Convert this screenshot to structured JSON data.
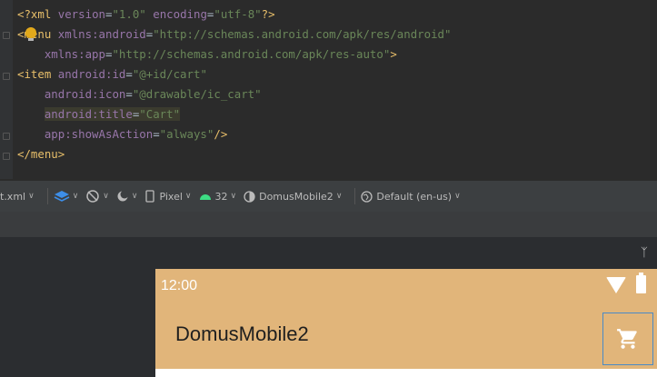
{
  "editor": {
    "lines": [
      {
        "parts": [
          [
            "pi",
            "<?xml "
          ],
          [
            "attr",
            "version"
          ],
          [
            "plain",
            "="
          ],
          [
            "val",
            "\"1.0\""
          ],
          [
            "plain",
            " "
          ],
          [
            "attr",
            "encoding"
          ],
          [
            "plain",
            "="
          ],
          [
            "val",
            "\"utf-8\""
          ],
          [
            "pi",
            "?>"
          ]
        ]
      },
      {
        "parts": [
          [
            "tag",
            "<menu "
          ],
          [
            "ns",
            "xmlns:android"
          ],
          [
            "plain",
            "="
          ],
          [
            "val",
            "\"http://schemas.android.com/apk/res/android\""
          ]
        ]
      },
      {
        "parts": [
          [
            "plain",
            "    "
          ],
          [
            "ns",
            "xmlns:app"
          ],
          [
            "plain",
            "="
          ],
          [
            "val",
            "\"http://schemas.android.com/apk/res-auto\""
          ],
          [
            "tag",
            ">"
          ]
        ]
      },
      {
        "parts": [
          [
            "tag",
            "<item "
          ],
          [
            "ns",
            "android:id"
          ],
          [
            "plain",
            "="
          ],
          [
            "val",
            "\"@+id/cart\""
          ]
        ]
      },
      {
        "parts": [
          [
            "plain",
            "    "
          ],
          [
            "ns",
            "android:icon"
          ],
          [
            "plain",
            "="
          ],
          [
            "val",
            "\"@drawable/ic_cart\""
          ]
        ]
      },
      {
        "parts": [
          [
            "plain",
            "    "
          ],
          [
            "ns",
            "android:title"
          ],
          [
            "plain",
            "="
          ],
          [
            "val",
            "\"Cart\""
          ]
        ],
        "highlight": true
      },
      {
        "parts": [
          [
            "plain",
            "    "
          ],
          [
            "ns",
            "app:showAsAction"
          ],
          [
            "plain",
            "="
          ],
          [
            "val",
            "\"always\""
          ],
          [
            "tag",
            "/>"
          ]
        ]
      },
      {
        "parts": [
          [
            "tag",
            "</menu>"
          ]
        ]
      }
    ]
  },
  "toolbar": {
    "file_label": "t.xml",
    "device_label": "Pixel",
    "api_label": "32",
    "theme_label": "DomusMobile2",
    "locale_label": "Default (en-us)"
  },
  "phone": {
    "time": "12:00",
    "app_title": "DomusMobile2",
    "colors": {
      "appbar": "#e1b57a",
      "selection_border": "#4a8ac6"
    }
  },
  "icons": {
    "cart": "cart-icon",
    "wifi": "wifi-icon",
    "battery": "battery-icon"
  }
}
